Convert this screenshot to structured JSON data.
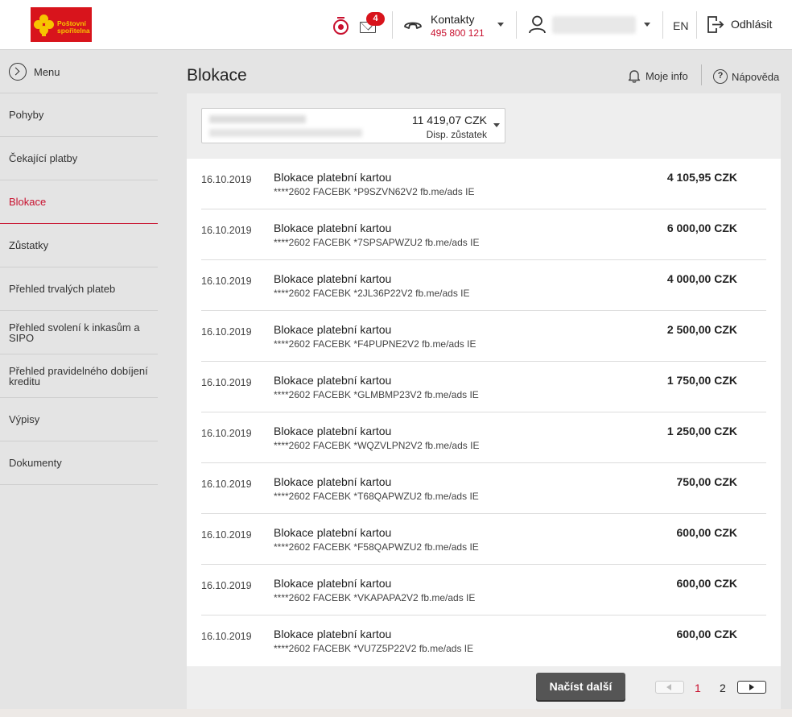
{
  "header": {
    "logo_text_line1": "Poštovní",
    "logo_text_line2": "spořitelna",
    "messages_count": "4",
    "contacts_label": "Kontakty",
    "contacts_phone": "495 800 121",
    "language": "EN",
    "logout_label": "Odhlásit"
  },
  "sidebar": {
    "menu_label": "Menu",
    "items": [
      {
        "label": "Pohyby"
      },
      {
        "label": "Čekající platby"
      },
      {
        "label": "Blokace"
      },
      {
        "label": "Zůstatky"
      },
      {
        "label": "Přehled trvalých plateb"
      },
      {
        "label": "Přehled svolení k inkasům a SIPO"
      },
      {
        "label": "Přehled pravidelného dobíjení kreditu"
      },
      {
        "label": "Výpisy"
      },
      {
        "label": "Dokumenty"
      }
    ]
  },
  "main": {
    "title": "Blokace",
    "moje_info": "Moje info",
    "napoveda": "Nápověda",
    "account": {
      "amount": "11 419,07 CZK",
      "amount_label": "Disp. zůstatek"
    },
    "rows": [
      {
        "date": "16.10.2019",
        "title": "Blokace platební kartou",
        "desc": "****2602 FACEBK *P9SZVN62V2 fb.me/ads IE",
        "amount": "4 105,95 CZK"
      },
      {
        "date": "16.10.2019",
        "title": "Blokace platební kartou",
        "desc": "****2602 FACEBK *7SPSAPWZU2 fb.me/ads IE",
        "amount": "6 000,00 CZK"
      },
      {
        "date": "16.10.2019",
        "title": "Blokace platební kartou",
        "desc": "****2602 FACEBK *2JL36P22V2 fb.me/ads IE",
        "amount": "4 000,00 CZK"
      },
      {
        "date": "16.10.2019",
        "title": "Blokace platební kartou",
        "desc": "****2602 FACEBK *F4PUPNE2V2 fb.me/ads IE",
        "amount": "2 500,00 CZK"
      },
      {
        "date": "16.10.2019",
        "title": "Blokace platební kartou",
        "desc": "****2602 FACEBK *GLMBMP23V2 fb.me/ads IE",
        "amount": "1 750,00 CZK"
      },
      {
        "date": "16.10.2019",
        "title": "Blokace platební kartou",
        "desc": "****2602 FACEBK *WQZVLPN2V2 fb.me/ads IE",
        "amount": "1 250,00 CZK"
      },
      {
        "date": "16.10.2019",
        "title": "Blokace platební kartou",
        "desc": "****2602 FACEBK *T68QAPWZU2 fb.me/ads IE",
        "amount": "750,00 CZK"
      },
      {
        "date": "16.10.2019",
        "title": "Blokace platební kartou",
        "desc": "****2602 FACEBK *F58QAPWZU2 fb.me/ads IE",
        "amount": "600,00 CZK"
      },
      {
        "date": "16.10.2019",
        "title": "Blokace platební kartou",
        "desc": "****2602 FACEBK *VKAPAPA2V2 fb.me/ads IE",
        "amount": "600,00 CZK"
      },
      {
        "date": "16.10.2019",
        "title": "Blokace platební kartou",
        "desc": "****2602 FACEBK *VU7Z5P22V2 fb.me/ads IE",
        "amount": "600,00 CZK"
      }
    ],
    "load_more": "Načíst další",
    "pages": [
      "1",
      "2"
    ]
  },
  "colors": {
    "brand_red": "#d8141c",
    "accent_red": "#c8102e",
    "brand_yellow": "#f7c400"
  }
}
